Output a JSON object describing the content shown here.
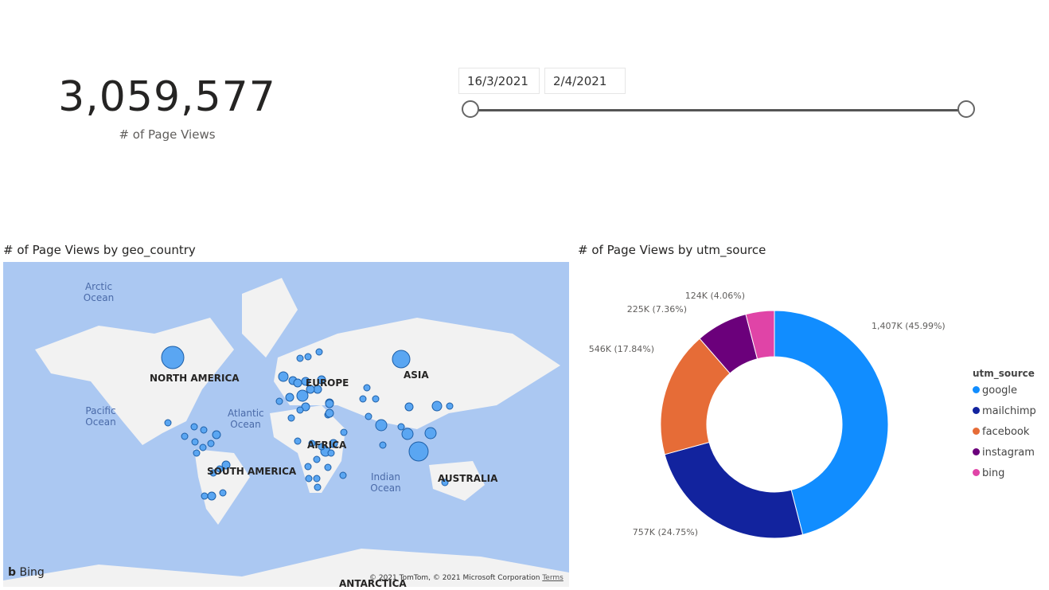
{
  "kpi": {
    "value": "3,059,577",
    "label": "# of Page Views"
  },
  "slicer": {
    "start": "16/3/2021",
    "end": "2/4/2021"
  },
  "map": {
    "title": "# of Page Views by geo_country",
    "labels": {
      "arctic": "Arctic Ocean",
      "pacific": "Pacific Ocean",
      "atlantic": "Atlantic Ocean",
      "indian": "Indian Ocean",
      "na": "NORTH AMERICA",
      "sa": "SOUTH AMERICA",
      "europe": "EUROPE",
      "africa": "AFRICA",
      "asia": "ASIA",
      "australia": "AUSTRALIA",
      "antarctica": "ANTARCTICA"
    },
    "bing": "Bing",
    "copyright": "© 2021 TomTom, © 2021 Microsoft Corporation",
    "terms": "Terms"
  },
  "chart_data": {
    "type": "pie",
    "title": "# of Page Views by utm_source",
    "legend_title": "utm_source",
    "legend_position": "right",
    "categories": [
      "google",
      "mailchimp",
      "facebook",
      "instagram",
      "bing"
    ],
    "values": [
      1407,
      757,
      546,
      225,
      124
    ],
    "labels": [
      "1,407K (45.99%)",
      "757K (24.75%)",
      "546K (17.84%)",
      "225K (7.36%)",
      "124K (4.06%)"
    ],
    "colors": [
      "#118dff",
      "#12239e",
      "#e66c37",
      "#6b007b",
      "#e044a7"
    ]
  }
}
